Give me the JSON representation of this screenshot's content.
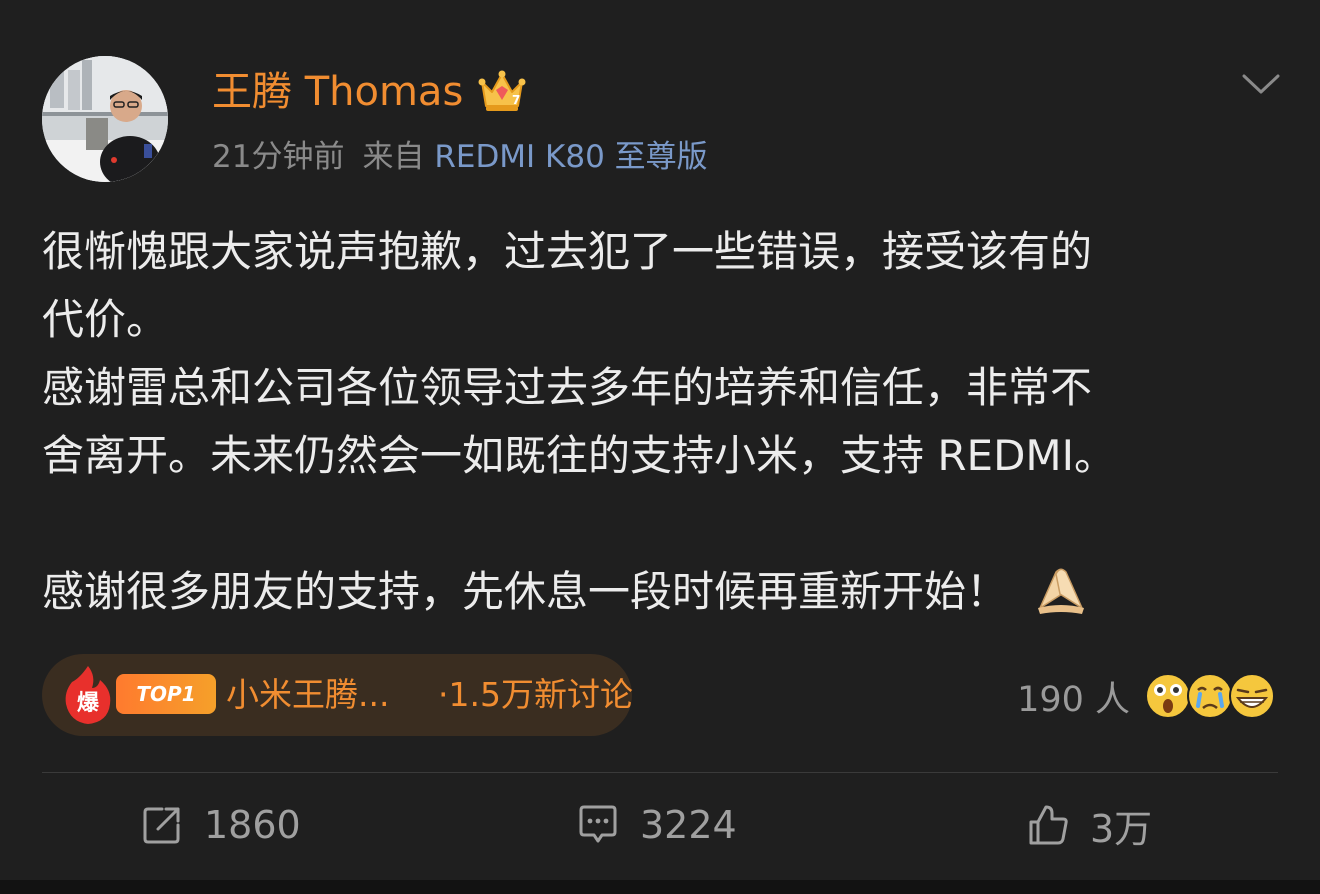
{
  "post": {
    "username": "王腾 Thomas",
    "badge_icon": "crown-icon",
    "time": "21分钟前",
    "source_prefix": "来自",
    "device": "REDMI K80 至尊版",
    "lines": [
      "很惭愧跟大家说声抱歉，过去犯了一些错误，接受该有的",
      "代价。",
      "感谢雷总和公司各位领导过去多年的培养和信任，非常不",
      "舍离开。未来仍然会一如既往的支持小米，支持 REDMI。",
      "",
      "感谢很多朋友的支持，先休息一段时候再重新开始！"
    ]
  },
  "topic": {
    "hot_icon": "爆",
    "rank": "TOP1",
    "title": "小米王腾...",
    "count": "·1.5万新讨论"
  },
  "reactions": {
    "count": "190 人",
    "faces": [
      "shocked-face-icon",
      "crying-face-icon",
      "laughing-face-icon"
    ]
  },
  "actions": {
    "share": "1860",
    "comment": "3224",
    "like": "3万"
  },
  "colors": {
    "background": "#1f1f1f",
    "username": "#f18d31",
    "device_link": "#7a99c9",
    "meta_text": "#8a8a8a",
    "body_text": "#ececec"
  }
}
